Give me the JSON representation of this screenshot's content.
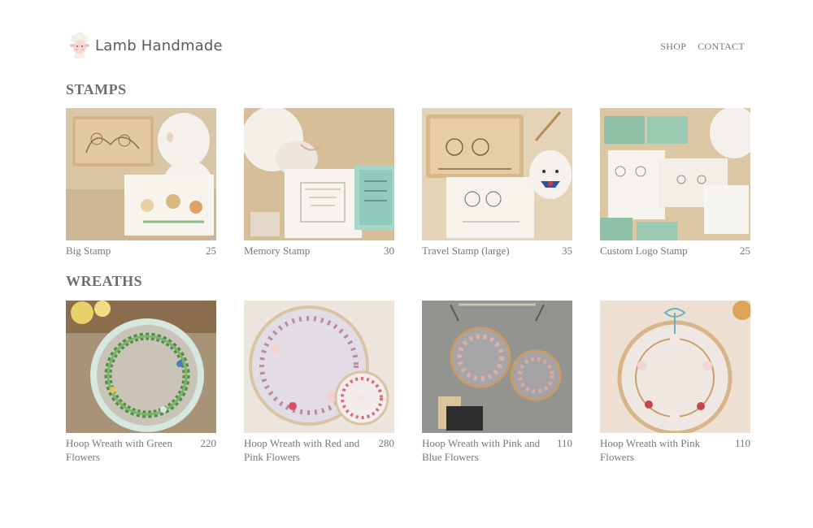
{
  "brand": {
    "name": "Lamb Handmade"
  },
  "nav": {
    "shop": "SHOP",
    "contact": "CONTACT"
  },
  "sections": [
    {
      "title": "STAMPS",
      "products": [
        {
          "name": "Big Stamp",
          "price": "25"
        },
        {
          "name": "Memory Stamp",
          "price": "30"
        },
        {
          "name": "Travel Stamp (large)",
          "price": "35"
        },
        {
          "name": "Custom Logo Stamp",
          "price": "25"
        }
      ]
    },
    {
      "title": "WREATHS",
      "products": [
        {
          "name": "Hoop Wreath with Green Flowers",
          "price": "220"
        },
        {
          "name": "Hoop Wreath with Red and Pink Flowers",
          "price": "280"
        },
        {
          "name": "Hoop Wreath with Pink and Blue Flowers",
          "price": "110"
        },
        {
          "name": "Hoop Wreath with Pink Flowers",
          "price": "110"
        }
      ]
    }
  ]
}
